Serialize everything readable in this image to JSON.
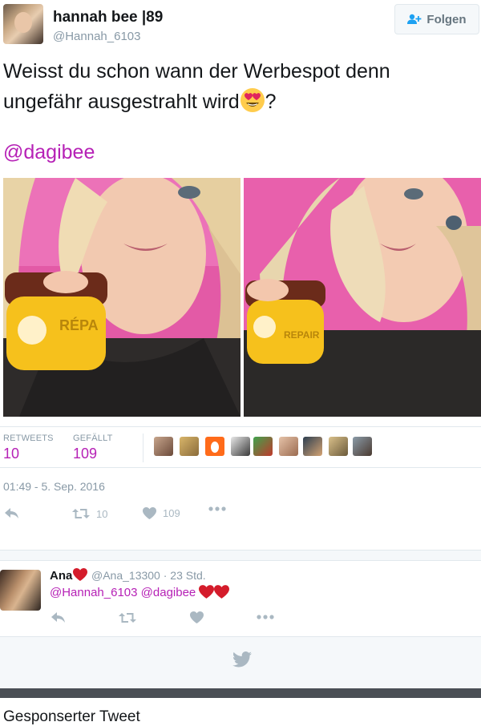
{
  "header": {
    "display_name": "hannah bee |89",
    "screen_name": "@Hannah_6103",
    "follow_label": "Folgen"
  },
  "tweet": {
    "text_line1": "Weisst du schon wann der Werbespot denn",
    "text_line2": "ungefähr ausgestrahlt wird",
    "text_end": "?",
    "mention": "@dagibee"
  },
  "stats": {
    "retweets_label": "RETWEETS",
    "retweets_value": "10",
    "likes_label": "GEFÄLLT",
    "likes_value": "109"
  },
  "timestamp": "01:49 - 5. Sep. 2016",
  "actions": {
    "retweet_count": "10",
    "like_count": "109"
  },
  "reply": {
    "name": "Ana",
    "screen_name": "@Ana_13300",
    "time": "23 Std.",
    "mention1": "@Hannah_6103",
    "mention2": "@dagibee"
  },
  "sponsored_label": "Gesponserter Tweet",
  "colors": {
    "accent": "#b621b6",
    "muted": "#8899a6",
    "icon": "#aab8c2",
    "heart": "#e0245e"
  }
}
